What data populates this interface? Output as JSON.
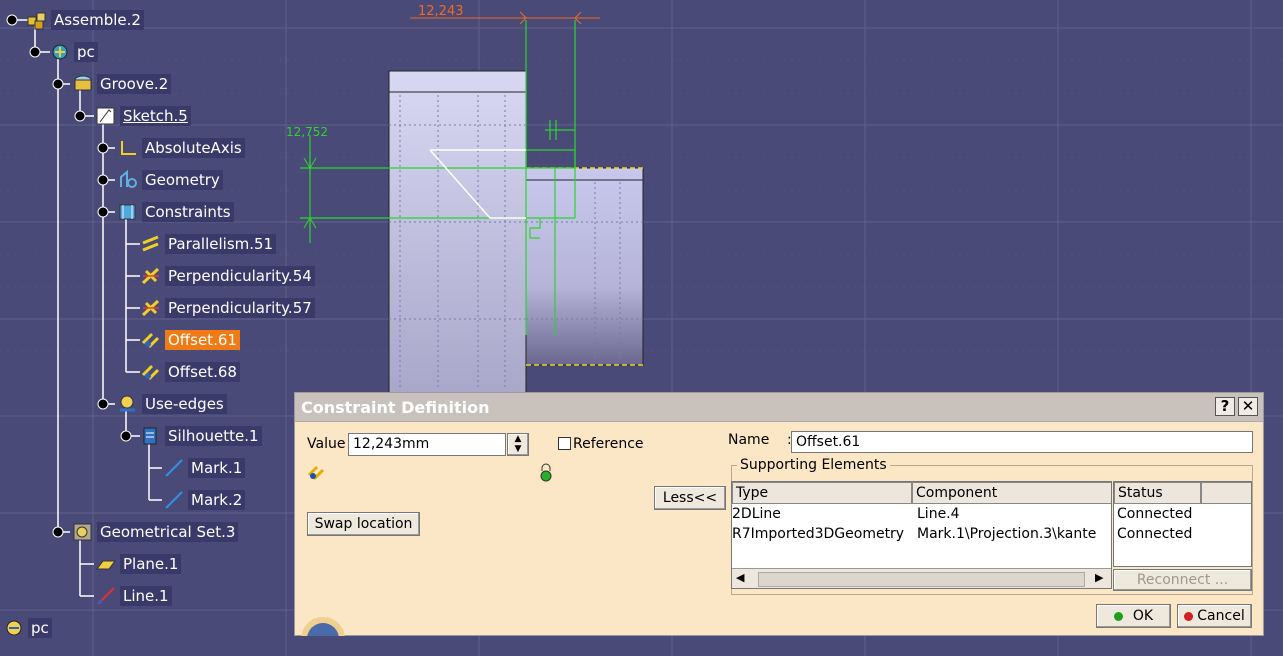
{
  "tree": {
    "items": [
      {
        "label": "Assemble.2",
        "icon": "assembly-icon"
      },
      {
        "label": "pc",
        "icon": "part-icon"
      },
      {
        "label": "Groove.2",
        "icon": "groove-icon"
      },
      {
        "label": "Sketch.5",
        "icon": "sketch-icon"
      },
      {
        "label": "AbsoluteAxis",
        "icon": "axis-icon"
      },
      {
        "label": "Geometry",
        "icon": "geometry-icon"
      },
      {
        "label": "Constraints",
        "icon": "constraints-icon"
      },
      {
        "label": "Parallelism.51",
        "icon": "parallelism-icon"
      },
      {
        "label": "Perpendicularity.54",
        "icon": "perpendicularity-icon"
      },
      {
        "label": "Perpendicularity.57",
        "icon": "perpendicularity-icon"
      },
      {
        "label": "Offset.61",
        "icon": "offset-icon"
      },
      {
        "label": "Offset.68",
        "icon": "offset-icon"
      },
      {
        "label": "Use-edges",
        "icon": "use-edges-icon"
      },
      {
        "label": "Silhouette.1",
        "icon": "silhouette-icon"
      },
      {
        "label": "Mark.1",
        "icon": "mark-line-icon"
      },
      {
        "label": "Mark.2",
        "icon": "mark-line-icon"
      },
      {
        "label": "Geometrical Set.3",
        "icon": "geometrical-set-icon"
      },
      {
        "label": "Plane.1",
        "icon": "plane-icon"
      },
      {
        "label": "Line.1",
        "icon": "line-icon"
      },
      {
        "label": "pc",
        "icon": "part-icon"
      }
    ]
  },
  "viewport": {
    "dim_horizontal": "12,243",
    "dim_vertical": "12,752"
  },
  "dialog": {
    "title": "Constraint Definition",
    "help_label": "?",
    "close_label": "✕",
    "value_label": "Value",
    "value": "12,243mm",
    "reference_label": "Reference",
    "swap_label": "Swap location",
    "less_label": "Less<<",
    "name_label": "Name",
    "name_value": "Offset.61",
    "supporting_label": "Supporting Elements",
    "columns": [
      "Type",
      "Component",
      "Status"
    ],
    "rows": [
      {
        "type": "2DLine",
        "component": "Line.4",
        "status": "Connected"
      },
      {
        "type": "R7Imported3DGeometry",
        "component": "Mark.1\\Projection.3\\kante",
        "status": "Connected"
      }
    ],
    "reconnect_label": "Reconnect ...",
    "ok_label": "OK",
    "cancel_label": "Cancel"
  }
}
